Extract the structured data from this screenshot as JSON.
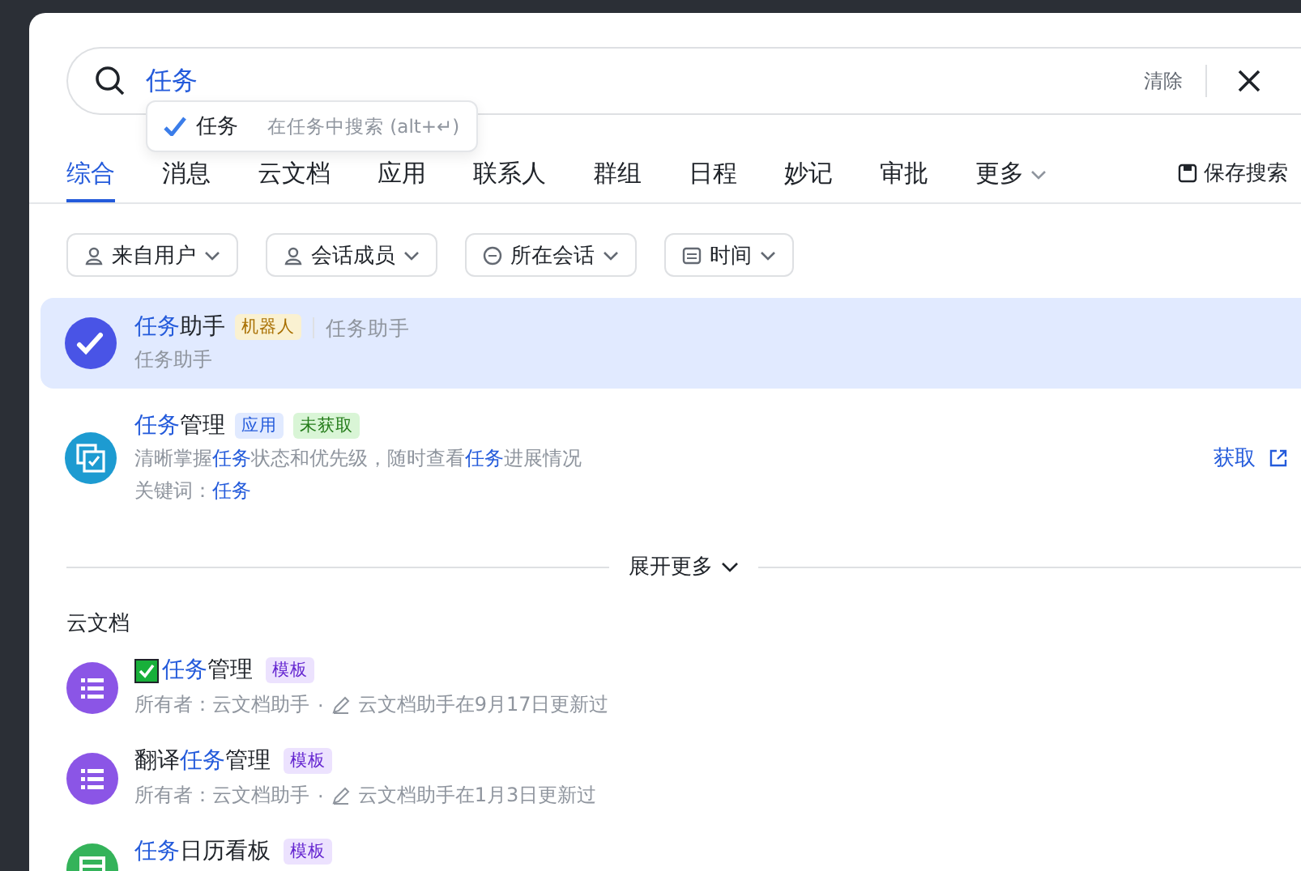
{
  "search": {
    "value": "任务",
    "clear_label": "清除",
    "suggestion": {
      "label": "任务",
      "hint": "在任务中搜索 (alt+↵)"
    }
  },
  "tabs": [
    {
      "label": "综合",
      "selected": true,
      "kind": "tab"
    },
    {
      "label": "消息",
      "selected": false,
      "kind": "tab"
    },
    {
      "label": "云文档",
      "selected": false,
      "kind": "tab"
    },
    {
      "label": "应用",
      "selected": false,
      "kind": "tab"
    },
    {
      "label": "联系人",
      "selected": false,
      "kind": "tab"
    },
    {
      "label": "群组",
      "selected": false,
      "kind": "tab"
    },
    {
      "label": "日程",
      "selected": false,
      "kind": "tab"
    },
    {
      "label": "妙记",
      "selected": false,
      "kind": "tab"
    },
    {
      "label": "审批",
      "selected": false,
      "kind": "tab"
    },
    {
      "label": "更多",
      "selected": false,
      "kind": "menu"
    }
  ],
  "save_search": "保存搜索",
  "filters": [
    {
      "label": "来自用户",
      "kind": "user"
    },
    {
      "label": "会话成员",
      "kind": "user"
    },
    {
      "label": "所在会话",
      "kind": "chat"
    },
    {
      "label": "时间",
      "kind": "calendar"
    }
  ],
  "results": [
    {
      "kind": "bot",
      "selected": true,
      "title": [
        {
          "text": "任务",
          "highlight": true
        },
        {
          "text": "助手",
          "highlight": false
        }
      ],
      "tags": [
        {
          "label": "机器人",
          "kind": "bot"
        }
      ],
      "alias": "任务助手",
      "lines": [
        [
          {
            "text": "任务助手",
            "highlight": false
          }
        ]
      ]
    },
    {
      "kind": "app",
      "selected": false,
      "title": [
        {
          "text": "任务",
          "highlight": true
        },
        {
          "text": "管理",
          "highlight": false
        }
      ],
      "tags": [
        {
          "label": "应用",
          "kind": "app"
        },
        {
          "label": "未获取",
          "kind": "status"
        }
      ],
      "lines": [
        [
          {
            "text": "清晰掌握",
            "highlight": false
          },
          {
            "text": "任务",
            "highlight": true
          },
          {
            "text": "状态和优先级，随时查看",
            "highlight": false
          },
          {
            "text": "任务",
            "highlight": true
          },
          {
            "text": "进展情况",
            "highlight": false
          }
        ],
        [
          {
            "text": "关键词：",
            "highlight": false
          },
          {
            "text": "任务",
            "highlight": true
          }
        ]
      ],
      "action": "获取"
    }
  ],
  "expand_more": "展开更多",
  "docs": {
    "title": "云文档",
    "items": [
      {
        "kind": "list",
        "checkbox": true,
        "title": [
          {
            "text": "任务",
            "highlight": true
          },
          {
            "text": "管理",
            "highlight": false
          }
        ],
        "tag": "模板",
        "owner": "所有者：云文档助手",
        "separator": "·",
        "updated": "云文档助手在9月17日更新过"
      },
      {
        "kind": "list",
        "checkbox": false,
        "title": [
          {
            "text": "翻译",
            "highlight": false
          },
          {
            "text": "任务",
            "highlight": true
          },
          {
            "text": "管理",
            "highlight": false
          }
        ],
        "tag": "模板",
        "owner": "所有者：云文档助手",
        "separator": "·",
        "updated": "云文档助手在1月3日更新过"
      },
      {
        "kind": "board",
        "checkbox": false,
        "title": [
          {
            "text": "任务",
            "highlight": true
          },
          {
            "text": "日历看板",
            "highlight": false
          }
        ],
        "tag": "模板"
      }
    ]
  }
}
